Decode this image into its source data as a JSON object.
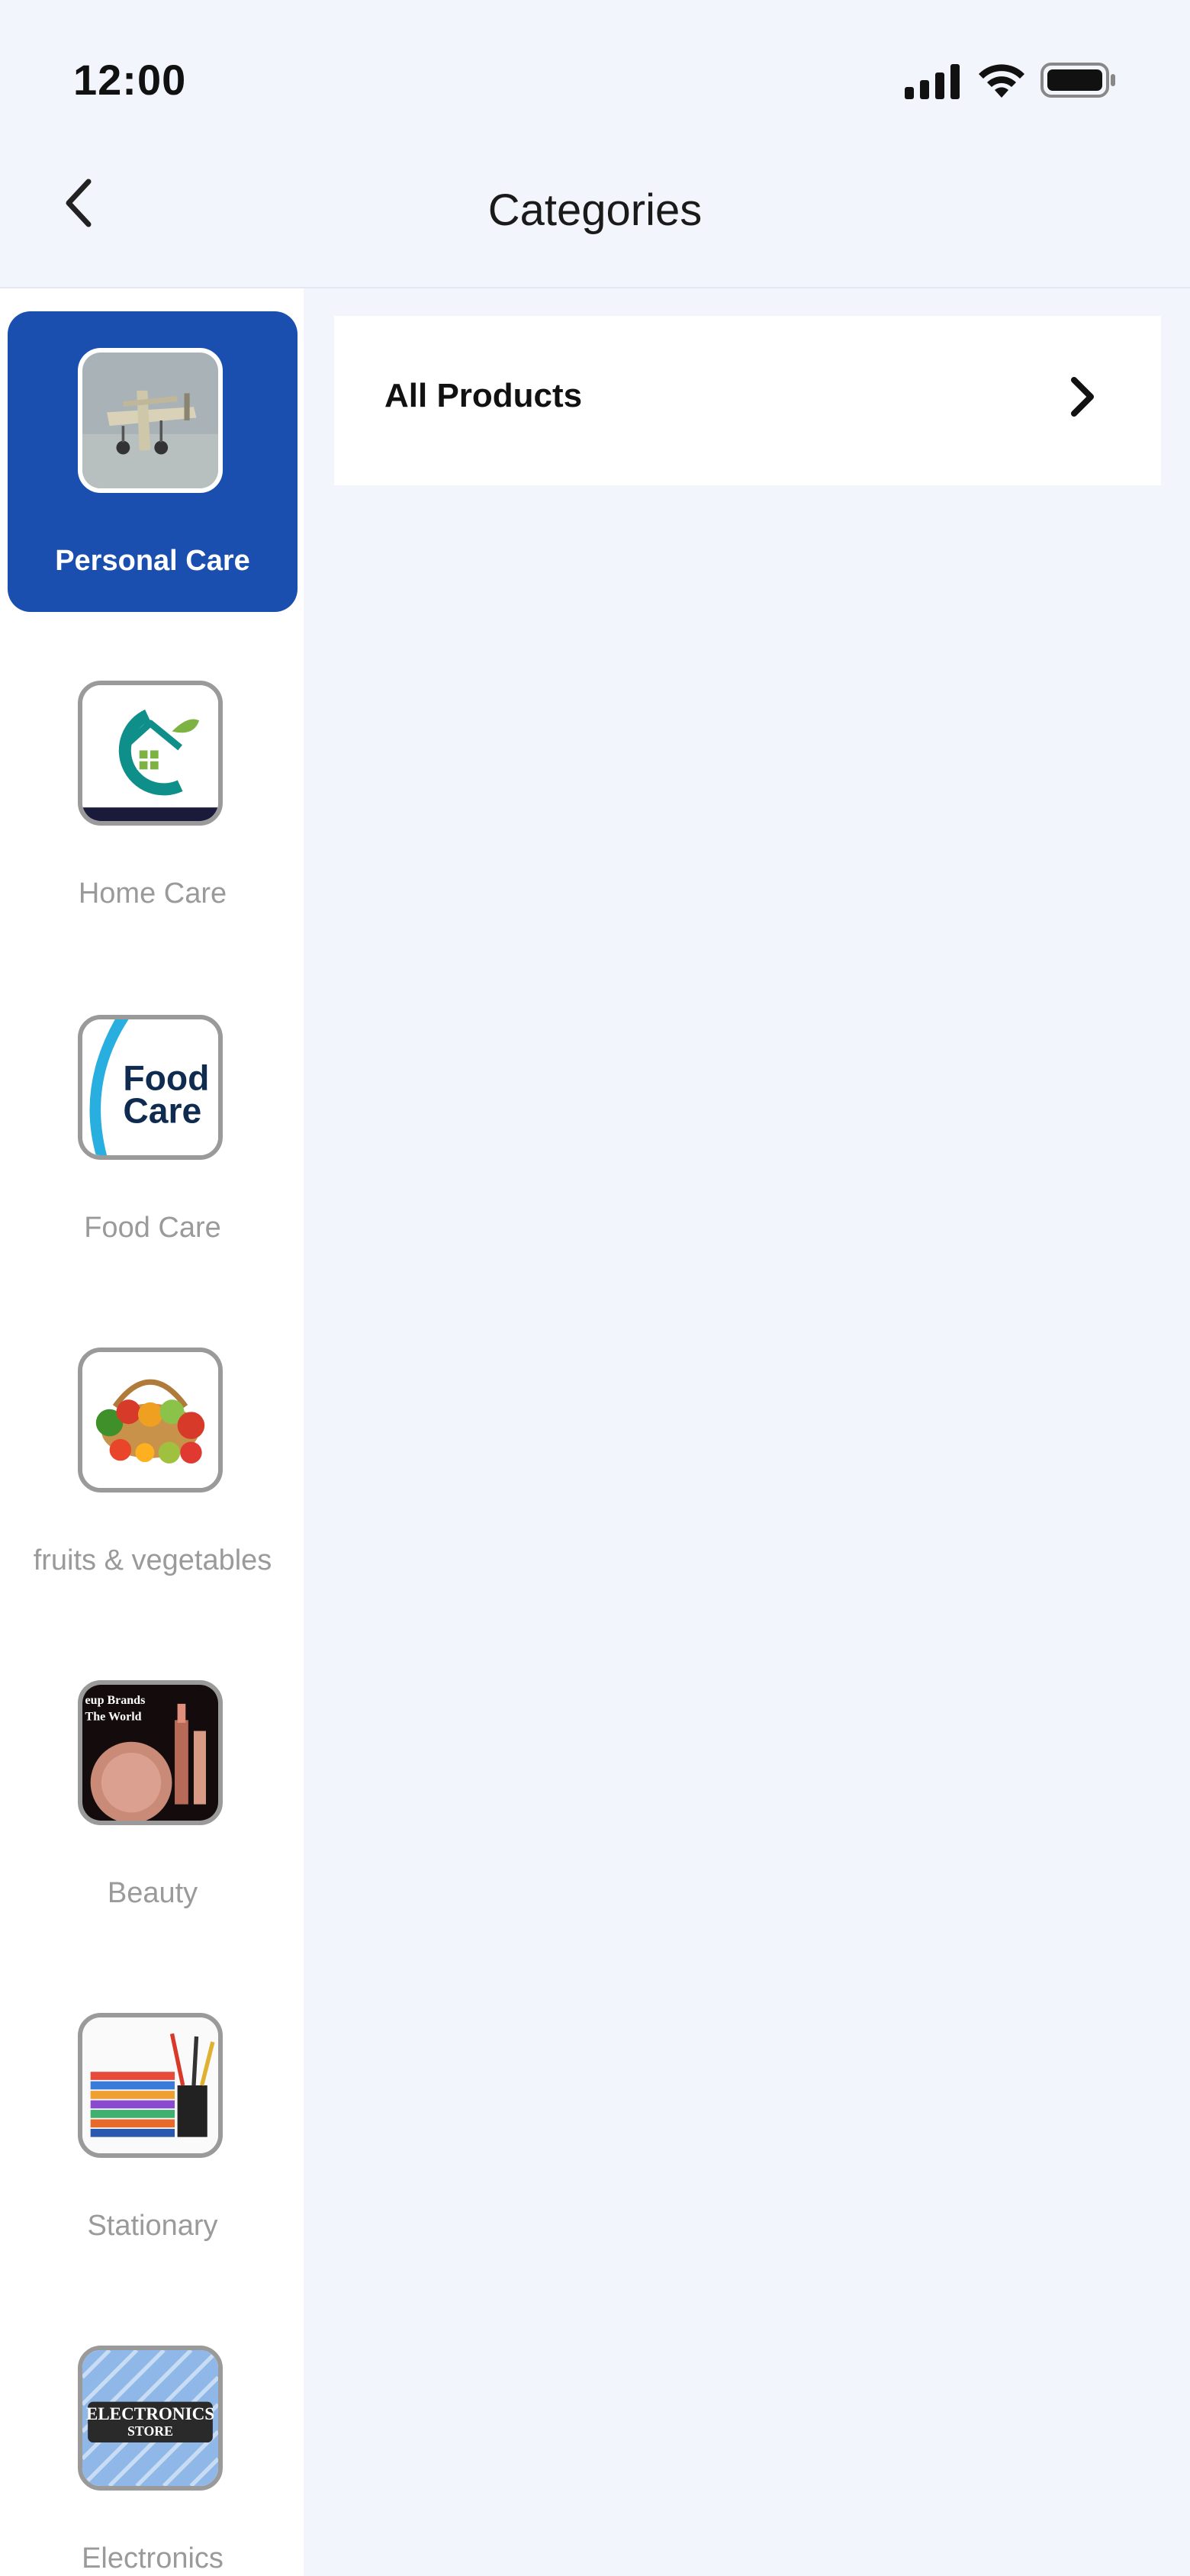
{
  "status_bar": {
    "time": "12:00"
  },
  "header": {
    "title": "Categories"
  },
  "categories": [
    {
      "label": "Personal Care",
      "active": true,
      "icon": "airplane-image"
    },
    {
      "label": "Home Care",
      "active": false,
      "icon": "home-care-logo"
    },
    {
      "label": "Food Care",
      "active": false,
      "icon": "food-care-logo",
      "logo_text": [
        "Food",
        "Care"
      ]
    },
    {
      "label": "fruits & vegetables",
      "active": false,
      "icon": "fruit-basket-image"
    },
    {
      "label": "Beauty",
      "active": false,
      "icon": "makeup-image",
      "image_text": [
        "eup Brands",
        "The World"
      ]
    },
    {
      "label": "Stationary",
      "active": false,
      "icon": "books-pens-image"
    },
    {
      "label": "Electronics",
      "active": false,
      "icon": "electronics-store-image",
      "image_text": [
        "ELECTRONICS",
        "STORE"
      ]
    }
  ],
  "main": {
    "all_products_label": "All Products"
  },
  "colors": {
    "accent": "#1a4fb0",
    "background": "#f2f5fb",
    "inactive_text": "#9a9a9a"
  }
}
